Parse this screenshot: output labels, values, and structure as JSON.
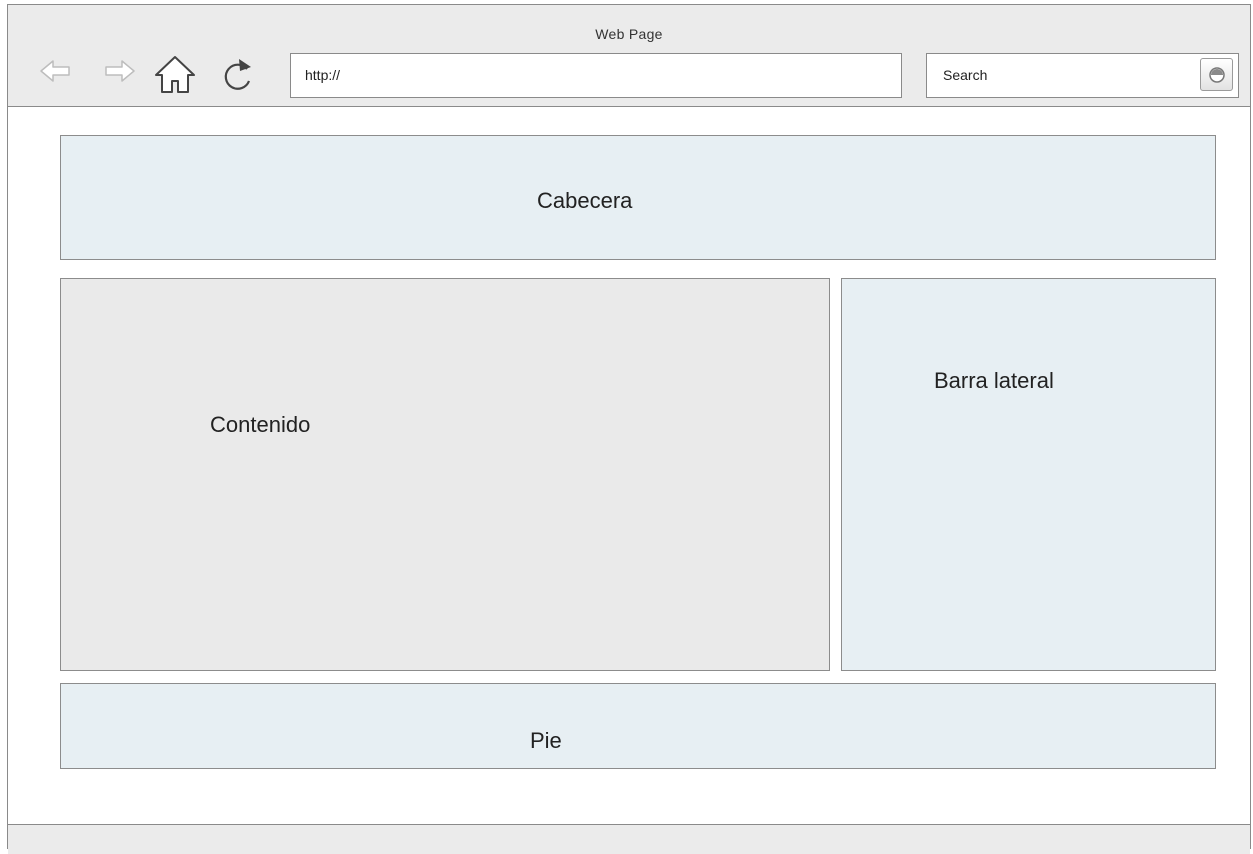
{
  "window": {
    "title": "Web Page"
  },
  "toolbar": {
    "url_value": "http://",
    "search_placeholder": "Search",
    "icons": [
      "back-arrow-icon",
      "forward-arrow-icon",
      "home-icon",
      "reload-icon",
      "search-icon"
    ]
  },
  "layout": {
    "header_label": "Cabecera",
    "content_label": "Contenido",
    "sidebar_label": "Barra lateral",
    "footer_label": "Pie"
  },
  "colors": {
    "chrome": "#ebebeb",
    "blue_region": "#e7eff3",
    "grey_region": "#eaeaea",
    "border": "#8c8c8c"
  }
}
